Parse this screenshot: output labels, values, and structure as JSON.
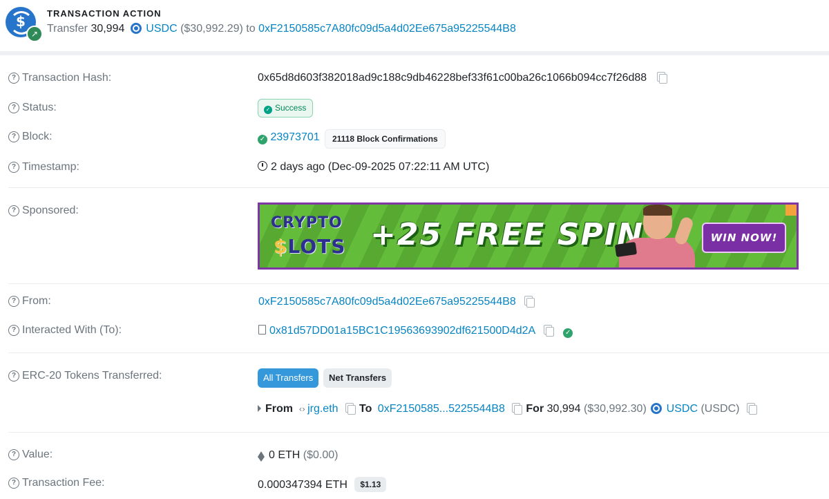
{
  "header": {
    "title": "TRANSACTION ACTION",
    "action_verb": "Transfer",
    "amount": "30,994",
    "token_symbol": "USDC",
    "usd_value": "($30,992.29)",
    "to_word": "to",
    "to_address": "0xF2150585c7A80fc09d5a4d02Ee675a95225544B8"
  },
  "rows": {
    "tx_hash": {
      "label": "Transaction Hash:",
      "value": "0x65d8d603f382018ad9c188c9db46228bef33f61c00ba26c1066b094cc7f26d88"
    },
    "status": {
      "label": "Status:",
      "value": "Success"
    },
    "block": {
      "label": "Block:",
      "number": "23973701",
      "confirmations": "21118 Block Confirmations"
    },
    "timestamp": {
      "label": "Timestamp:",
      "value": "2 days ago (Dec-09-2025 07:22:11 AM UTC)"
    },
    "sponsored": {
      "label": "Sponsored:",
      "banner": {
        "brand_line1": "CRYPTO",
        "brand_line2_s": "$",
        "brand_line2_rest": "LOTS",
        "headline": "+25 FREE SPINS",
        "cta": "WIN NOW!"
      }
    },
    "from": {
      "label": "From:",
      "address": "0xF2150585c7A80fc09d5a4d02Ee675a95225544B8"
    },
    "interacted_with": {
      "label": "Interacted With (To):",
      "address": "0x81d57DD01a15BC1C19563693902df621500D4d2A"
    },
    "erc20": {
      "label": "ERC-20 Tokens Transferred:",
      "tabs": [
        "All Transfers",
        "Net Transfers"
      ],
      "transfer": {
        "from_word": "From",
        "from_name": "jrg.eth",
        "to_word": "To",
        "to_short": "0xF2150585...5225544B8",
        "for_word": "For",
        "amount": "30,994",
        "usd": "($30,992.30)",
        "token_name": "USDC",
        "token_symbol": "(USDC)"
      }
    },
    "value": {
      "label": "Value:",
      "amount": "0 ETH",
      "usd": "($0.00)"
    },
    "fee": {
      "label": "Transaction Fee:",
      "amount": "0.000347394 ETH",
      "usd": "$1.13"
    }
  },
  "icons": {
    "help": "question-circle-icon",
    "copy": "copy-icon",
    "check": "check-circle-icon",
    "clock": "clock-icon",
    "contract": "file-contract-icon",
    "eth": "ethereum-icon",
    "ens": "ens-icon"
  },
  "colors": {
    "link": "#0784c3",
    "success": "#00a186",
    "muted": "#6c757d",
    "primary_button": "#3498db"
  }
}
